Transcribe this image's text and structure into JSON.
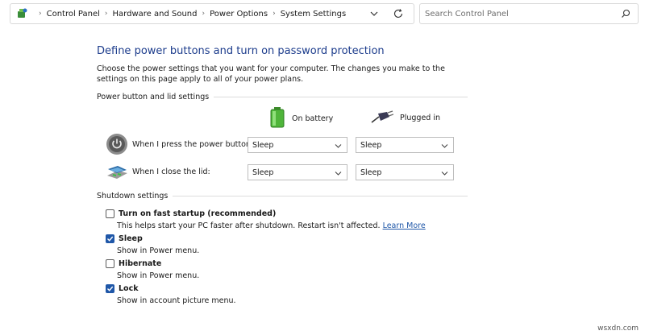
{
  "breadcrumb": [
    "Control Panel",
    "Hardware and Sound",
    "Power Options",
    "System Settings"
  ],
  "search": {
    "placeholder": "Search Control Panel"
  },
  "page": {
    "title": "Define power buttons and turn on password protection",
    "description": "Choose the power settings that you want for your computer. The changes you make to the settings on this page apply to all of your power plans."
  },
  "power_section": {
    "heading": "Power button and lid settings",
    "col_battery": "On battery",
    "col_plugged": "Plugged in",
    "rows": [
      {
        "label": "When I press the power button:",
        "battery": "Sleep",
        "plugged": "Sleep"
      },
      {
        "label": "When I close the lid:",
        "battery": "Sleep",
        "plugged": "Sleep"
      }
    ]
  },
  "shutdown_section": {
    "heading": "Shutdown settings",
    "items": [
      {
        "label": "Turn on fast startup (recommended)",
        "desc": "This helps start your PC faster after shutdown. Restart isn't affected.",
        "link": "Learn More",
        "checked": false
      },
      {
        "label": "Sleep",
        "desc": "Show in Power menu.",
        "checked": true
      },
      {
        "label": "Hibernate",
        "desc": "Show in Power menu.",
        "checked": false
      },
      {
        "label": "Lock",
        "desc": "Show in account picture menu.",
        "checked": true
      }
    ]
  },
  "watermark": "wsxdn.com",
  "colors": {
    "title": "#1c3c8c",
    "link": "#1f57a8",
    "checkbox": "#1f57a8"
  }
}
